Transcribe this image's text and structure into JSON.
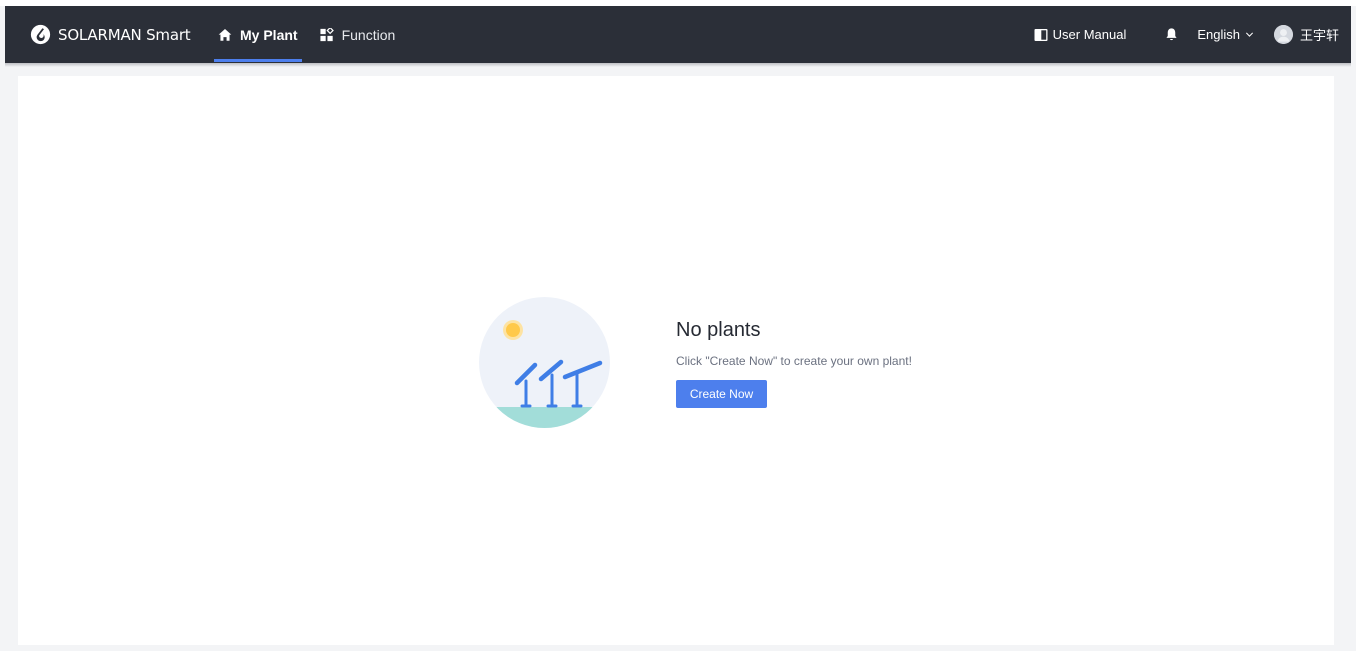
{
  "header": {
    "brand_name": "SOLARMAN Smart",
    "nav": [
      {
        "label": "My Plant",
        "icon": "home-icon",
        "active": true
      },
      {
        "label": "Function",
        "icon": "apps-icon",
        "active": false
      }
    ],
    "user_manual_label": "User Manual",
    "language_label": "English",
    "user_name": "王宇轩"
  },
  "empty_state": {
    "title": "No plants",
    "description": "Click \"Create Now\" to create your own plant!",
    "button_label": "Create Now"
  },
  "colors": {
    "topbar": "#2b2f38",
    "accent": "#4d7fed",
    "page_background": "#f3f4f6",
    "sun": "#ffc94a",
    "ground": "#a2ddd9"
  }
}
